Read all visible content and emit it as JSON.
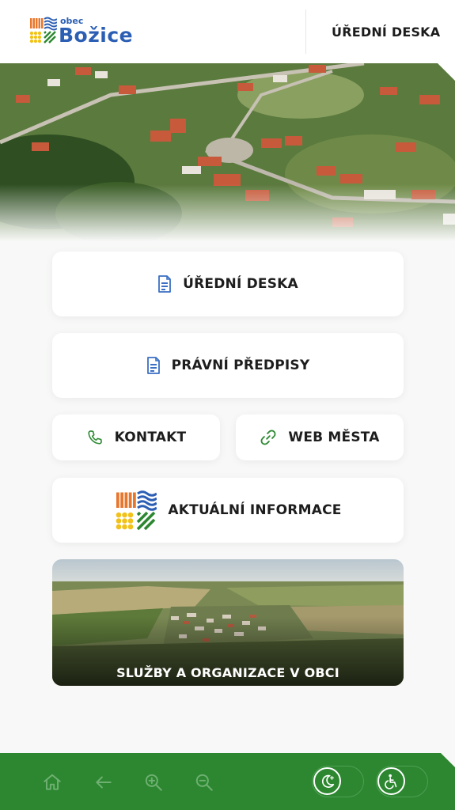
{
  "header": {
    "logo": {
      "small": "obec",
      "name": "Božice"
    },
    "nav_link": "ÚŘEDNÍ DESKA"
  },
  "menu": {
    "uredni_deska": {
      "label": "ÚŘEDNÍ DESKA",
      "icon": "document-icon"
    },
    "pravni_predpisy": {
      "label": "PRÁVNÍ PŘEDPISY",
      "icon": "document-icon"
    },
    "kontakt": {
      "label": "KONTAKT",
      "icon": "phone-icon"
    },
    "web_mesta": {
      "label": "WEB MĚSTA",
      "icon": "link-icon"
    },
    "aktualni_informace": {
      "label": "AKTUÁLNÍ INFORMACE",
      "icon": "village-logo-icon"
    },
    "sluzby": {
      "label": "SLUŽBY A ORGANIZACE V OBCI"
    }
  },
  "bottom_bar": {
    "icons": [
      "home-icon",
      "back-arrow-icon",
      "zoom-in-icon",
      "zoom-out-icon"
    ],
    "toggles": [
      "dark-mode-icon",
      "accessibility-icon"
    ]
  },
  "colors": {
    "brand_blue": "#2c5fb4",
    "brand_green": "#2c8730",
    "icon_blue": "#3a6fc4",
    "icon_green": "#2f8a34"
  }
}
